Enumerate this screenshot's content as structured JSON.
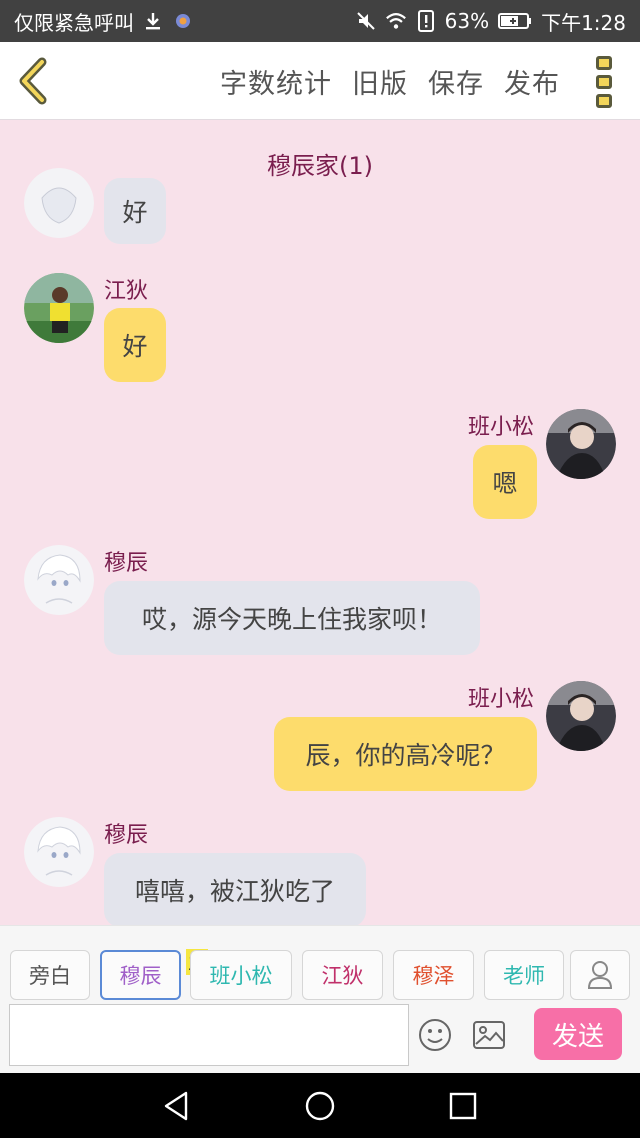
{
  "status_bar": {
    "carrier_text": "仅限紧急呼叫",
    "battery": "63%",
    "time": "下午1:28",
    "icons": [
      "download-icon",
      "app-icon",
      "mute-icon",
      "wifi-icon",
      "alert-icon",
      "battery-icon"
    ]
  },
  "toolbar": {
    "word_count": "字数统计",
    "old_version": "旧版",
    "save": "保存",
    "publish": "发布"
  },
  "chat": {
    "title": "穆辰家(1)",
    "messages": [
      {
        "speaker": "",
        "text": "好",
        "side": "left"
      },
      {
        "speaker": "江狄",
        "text": "好",
        "side": "left"
      },
      {
        "speaker": "班小松",
        "text": "嗯",
        "side": "right"
      },
      {
        "speaker": "穆辰",
        "text": "哎，源今天晚上住我家呗！",
        "side": "left"
      },
      {
        "speaker": "班小松",
        "text": "辰，你的高冷呢？",
        "side": "right"
      },
      {
        "speaker": "穆辰",
        "text": "嘻嘻，被江狄吃了",
        "side": "left"
      }
    ]
  },
  "roles": {
    "items": [
      "旁白",
      "穆辰",
      "班小松",
      "江狄",
      "穆泽",
      "老师"
    ],
    "host_badge": "主",
    "colors": {
      "旁白": "#555555",
      "穆辰": "#a060c8",
      "班小松": "#2fb8b0",
      "江狄": "#c0306a",
      "穆泽": "#e0502e",
      "老师": "#2fb8b0"
    }
  },
  "composer": {
    "input_value": "",
    "send_label": "发送"
  },
  "colors": {
    "background": "#f8e1ea",
    "left_bubble": "#e3e4ec",
    "right_bubble": "#fddc6c",
    "name_color": "#7a1e4e",
    "send_button": "#f76fa7"
  }
}
